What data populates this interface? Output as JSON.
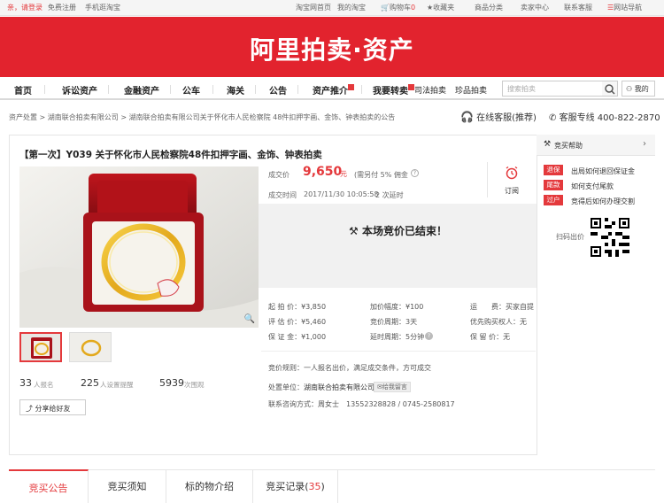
{
  "topbar": {
    "greet": "亲，请登录",
    "register": "免费注册",
    "mobile": "手机逛淘宝",
    "home": "淘宝网首页",
    "mytaobao": "我的淘宝",
    "cart": "购物车",
    "cart_count": "0",
    "favorites": "收藏夹",
    "categories": "商品分类",
    "seller": "卖家中心",
    "support": "联系客服",
    "sitemap": "网站导航"
  },
  "banner": {
    "title": "阿里拍卖·资产"
  },
  "nav": {
    "items": [
      "首页",
      "诉讼资产",
      "金融资产",
      "公车",
      "海关",
      "公告",
      "资产推介",
      "我要转卖",
      "司法拍卖",
      "珍品拍卖"
    ],
    "search_placeholder": "搜索拍卖",
    "mine": "我的"
  },
  "breadcrumb": "资产处置 > 湖南联合拍卖有限公司 > 湖南联合拍卖有限公司关于怀化市人民检察院 48件扣押字画、金饰、钟表拍卖的公告",
  "service": {
    "online": "在线客服(推荐)",
    "hotline_label": "客服专线",
    "hotline": "400-822-2870"
  },
  "lot": {
    "title": "【第一次】Y039 关于怀化市人民检察院48件扣押字画、金饰、钟表拍卖",
    "deal_price_label": "成交价",
    "deal_price": "9,650",
    "price_unit": "元",
    "commission": "(需另付 5% 佣金",
    "deal_time_label": "成交时间",
    "deal_time": "2017/11/30 10:05:58",
    "delay_count": "2 次延时",
    "remind": "订阅",
    "ended": "本场竞价已结束！",
    "stats": [
      {
        "num": "33",
        "label": "人报名"
      },
      {
        "num": "225",
        "label": "人设置提醒"
      },
      {
        "num": "5939",
        "label": "次围观"
      }
    ],
    "share": "分享给好友"
  },
  "details": {
    "start_price": "起 拍 价：¥3,850",
    "eval_price": "评 估 价：¥5,460",
    "deposit": "保 证 金：¥1,000",
    "increment": "加价幅度：¥100",
    "period": "竞价周期：3天",
    "delay_period": "延时周期：5分钟",
    "shipping": "运　　费：买家自提",
    "priority": "优先购买权人：无",
    "reserve": "保 留 价：无",
    "rules": "竞价规则：一人报名出价，满足成交条件，方可成交",
    "disposer_label": "处置单位：",
    "disposer": "湖南联合拍卖有限公司",
    "message": "给我留言",
    "contact": "联系咨询方式：周女士　13552328828 / 0745-2580817"
  },
  "help": {
    "title": "竞买帮助",
    "items": [
      {
        "tag": "退保",
        "text": "出局如何退回保证金"
      },
      {
        "tag": "尾款",
        "text": "如何支付尾款"
      },
      {
        "tag": "过户",
        "text": "竞得后如何办理交割"
      }
    ],
    "qr_label": "扫码出价"
  },
  "tabs": [
    {
      "label": "竞买公告"
    },
    {
      "label": "竞买须知"
    },
    {
      "label": "标的物介绍"
    },
    {
      "label": "竞买记录",
      "count": "35"
    }
  ],
  "colors": {
    "brand_red": "#e2232e",
    "accent_red": "#e4393c"
  }
}
